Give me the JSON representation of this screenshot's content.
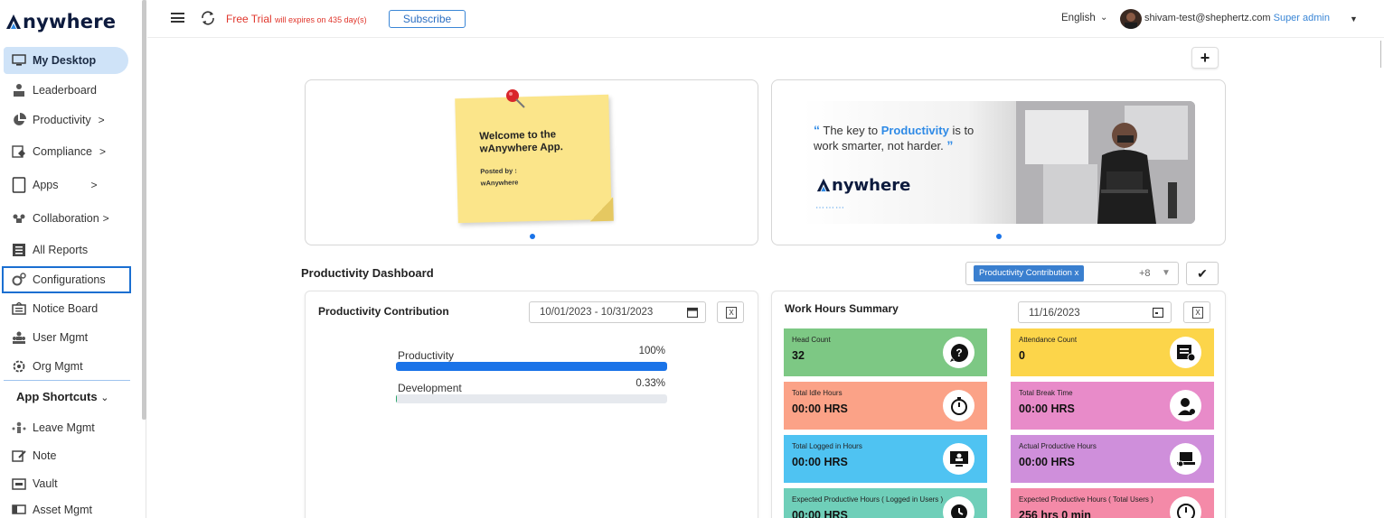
{
  "brand": {
    "logo_text": "nywhere"
  },
  "sidebar": {
    "items": [
      {
        "label": "My Desktop"
      },
      {
        "label": "Leaderboard"
      },
      {
        "label": "Productivity",
        "chevron": ">"
      },
      {
        "label": "Compliance",
        "chevron": ">"
      },
      {
        "label": "Apps",
        "chevron": ">"
      },
      {
        "label": "Collaboration",
        "chevron": ">"
      },
      {
        "label": "All Reports"
      },
      {
        "label": "Configurations"
      },
      {
        "label": "Notice Board"
      },
      {
        "label": "User Mgmt"
      },
      {
        "label": "Org Mgmt"
      }
    ],
    "shortcuts_title": "App Shortcuts",
    "shortcuts": [
      {
        "label": "Leave Mgmt"
      },
      {
        "label": "Note"
      },
      {
        "label": "Vault"
      },
      {
        "label": "Asset Mgmt"
      }
    ]
  },
  "topbar": {
    "trial_main": "Free Trial",
    "trial_sub": "will expires on 435 day(s)",
    "subscribe_label": "Subscribe",
    "language": "English",
    "user_email": "shivam-test@shephertz.com",
    "user_role": "Super admin"
  },
  "banners": {
    "note_title": "Welcome to the wAnywhere App.",
    "note_posted_label": "Posted by :",
    "note_posted_by": "wAnywhere",
    "quote_prefix": "The key to ",
    "quote_highlight": "Productivity",
    "quote_suffix": " is to work smarter, not harder.",
    "promo_logo": "nywhere"
  },
  "dashboard": {
    "title": "Productivity Dashboard",
    "selected_chip": "Productivity Contribution x",
    "more_count": "+8"
  },
  "contribution": {
    "title": "Productivity Contribution",
    "date_range": "10/01/2023 - 10/31/2023",
    "bars": [
      {
        "label": "Productivity",
        "pct_text": "100%",
        "fraction": 1.0
      },
      {
        "label": "Development",
        "pct_text": "0.33%",
        "fraction": 0.0033
      }
    ]
  },
  "work_hours": {
    "title": "Work Hours Summary",
    "date": "11/16/2023",
    "tiles": [
      {
        "label": "Head Count",
        "value": "32",
        "color": "#7dc884"
      },
      {
        "label": "Attendance Count",
        "value": "0",
        "color": "#fcd54a"
      },
      {
        "label": "Total Idle Hours",
        "value": "00:00 HRS",
        "color": "#fba287"
      },
      {
        "label": "Total Break Time",
        "value": "00:00 HRS",
        "color": "#e88bc9"
      },
      {
        "label": "Total Logged in Hours",
        "value": "00:00 HRS",
        "color": "#4fc3f2"
      },
      {
        "label": "Actual Productive Hours",
        "value": "00:00 HRS",
        "color": "#cf8fdb"
      },
      {
        "label": "Expected Productive Hours ( Logged in Users )",
        "value": "00:00 HRS",
        "color": "#6fcfb9"
      },
      {
        "label": "Expected Productive Hours ( Total Users )",
        "value": "256 hrs 0 min",
        "color": "#f48aa8"
      }
    ]
  },
  "colors": {
    "accent": "#1a73e8",
    "active_bg": "#cfe3f8",
    "trial": "#e0362c"
  }
}
